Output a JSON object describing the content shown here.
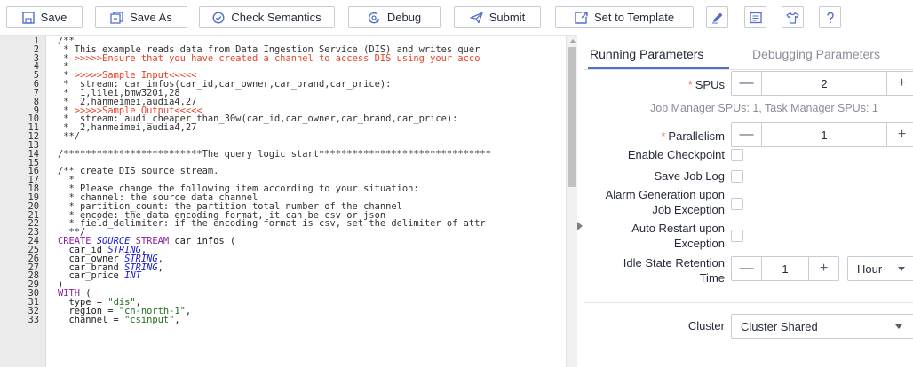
{
  "toolbar": {
    "save": "Save",
    "save_as": "Save As",
    "check_semantics": "Check Semantics",
    "debug": "Debug",
    "submit": "Submit",
    "set_to_template": "Set to Template",
    "accent": "#526ecc",
    "icons": [
      "save-icon",
      "save-as-icon",
      "check-semantics-icon",
      "debug-icon",
      "submit-icon",
      "set-template-icon",
      "pen-icon",
      "format-icon",
      "theme-icon",
      "help-icon"
    ]
  },
  "editor": {
    "lines": [
      {
        "n": "1",
        "segs": [
          {
            "t": "/**",
            "c": "com"
          }
        ]
      },
      {
        "n": "2",
        "segs": [
          {
            "t": " * This example reads data from Data Ingestion Service (DIS) and writes quer",
            "c": "com"
          }
        ]
      },
      {
        "n": "3",
        "segs": [
          {
            "t": " * ",
            "c": "com"
          },
          {
            "t": ">>>>>Ensure that you have created a channel to access DIS using your acco",
            "c": "red"
          }
        ]
      },
      {
        "n": "4",
        "segs": [
          {
            "t": " *",
            "c": "com"
          }
        ]
      },
      {
        "n": "5",
        "segs": [
          {
            "t": " * ",
            "c": "com"
          },
          {
            "t": ">>>>>Sample Input<<<<<",
            "c": "red"
          }
        ]
      },
      {
        "n": "6",
        "segs": [
          {
            "t": " *  stream: car_infos(car_id,car_owner,car_brand,car_price):",
            "c": "com"
          }
        ]
      },
      {
        "n": "7",
        "segs": [
          {
            "t": " *  1,lilei,bmw320i,28",
            "c": "com"
          }
        ]
      },
      {
        "n": "8",
        "segs": [
          {
            "t": " *  2,hanmeimei,audia4,27",
            "c": "com"
          }
        ]
      },
      {
        "n": "9",
        "segs": [
          {
            "t": " * ",
            "c": "com"
          },
          {
            "t": ">>>>>Sample Output<<<<<",
            "c": "red"
          }
        ]
      },
      {
        "n": "10",
        "segs": [
          {
            "t": " *  stream: audi_cheaper_than_30w(car_id,car_owner,car_brand,car_price):",
            "c": "com"
          }
        ]
      },
      {
        "n": "11",
        "segs": [
          {
            "t": " *  2,hanmeimei,audia4,27",
            "c": "com"
          }
        ]
      },
      {
        "n": "12",
        "segs": [
          {
            "t": " **/",
            "c": "com"
          }
        ]
      },
      {
        "n": "13",
        "segs": [
          {
            "t": "",
            "c": "com"
          }
        ]
      },
      {
        "n": "14",
        "segs": [
          {
            "t": "/*************************The query logic start*******************************",
            "c": "com"
          }
        ]
      },
      {
        "n": "15",
        "segs": [
          {
            "t": "",
            "c": "com"
          }
        ]
      },
      {
        "n": "16",
        "segs": [
          {
            "t": "/** create DIS source stream.",
            "c": "com"
          }
        ]
      },
      {
        "n": "17",
        "segs": [
          {
            "t": "  *",
            "c": "com"
          }
        ]
      },
      {
        "n": "18",
        "segs": [
          {
            "t": "  * Please change the following item according to your situation:",
            "c": "com"
          }
        ]
      },
      {
        "n": "19",
        "segs": [
          {
            "t": "  * channel: the source data channel",
            "c": "com"
          }
        ]
      },
      {
        "n": "20",
        "segs": [
          {
            "t": "  * partition_count: the partition total number of the channel",
            "c": "com"
          }
        ]
      },
      {
        "n": "21",
        "segs": [
          {
            "t": "  * encode: the data encoding format, it can be csv or json",
            "c": "com"
          }
        ]
      },
      {
        "n": "22",
        "segs": [
          {
            "t": "  * field_delimiter: if the encoding format is csv, set the delimiter of attr",
            "c": "com"
          }
        ]
      },
      {
        "n": "23",
        "segs": [
          {
            "t": "  **/",
            "c": "com"
          }
        ]
      },
      {
        "n": "24",
        "segs": [
          {
            "t": "CREATE ",
            "c": "kw"
          },
          {
            "t": "SOURCE",
            "c": "ty"
          },
          {
            "t": " STREAM ",
            "c": "kw"
          },
          {
            "t": "car_infos (",
            "c": "plain"
          }
        ]
      },
      {
        "n": "25",
        "segs": [
          {
            "t": "  car_id ",
            "c": "plain"
          },
          {
            "t": "STRING",
            "c": "ty"
          },
          {
            "t": ",",
            "c": "plain"
          }
        ]
      },
      {
        "n": "26",
        "segs": [
          {
            "t": "  car_owner ",
            "c": "plain"
          },
          {
            "t": "STRING",
            "c": "ty"
          },
          {
            "t": ",",
            "c": "plain"
          }
        ]
      },
      {
        "n": "27",
        "segs": [
          {
            "t": "  car_brand ",
            "c": "plain"
          },
          {
            "t": "STRING",
            "c": "ty"
          },
          {
            "t": ",",
            "c": "plain"
          }
        ]
      },
      {
        "n": "28",
        "segs": [
          {
            "t": "  car_price ",
            "c": "plain"
          },
          {
            "t": "INT",
            "c": "ty"
          }
        ]
      },
      {
        "n": "29",
        "segs": [
          {
            "t": ")",
            "c": "plain"
          }
        ]
      },
      {
        "n": "30",
        "segs": [
          {
            "t": "WITH",
            "c": "kw"
          },
          {
            "t": " (",
            "c": "plain"
          }
        ]
      },
      {
        "n": "31",
        "segs": [
          {
            "t": "  type = ",
            "c": "plain"
          },
          {
            "t": "\"dis\"",
            "c": "str"
          },
          {
            "t": ",",
            "c": "plain"
          }
        ]
      },
      {
        "n": "32",
        "segs": [
          {
            "t": "  region = ",
            "c": "plain"
          },
          {
            "t": "\"cn-north-1\"",
            "c": "str"
          },
          {
            "t": ",",
            "c": "plain"
          }
        ]
      },
      {
        "n": "33",
        "segs": [
          {
            "t": "  channel = ",
            "c": "plain"
          },
          {
            "t": "\"csinput\"",
            "c": "str"
          },
          {
            "t": ",",
            "c": "plain"
          }
        ]
      }
    ]
  },
  "panel": {
    "tabs": [
      {
        "label": "Running Parameters",
        "active": true
      },
      {
        "label": "Debugging Parameters",
        "active": false
      }
    ],
    "spus_label": "SPUs",
    "spus_value": "2",
    "spus_hint": "Job Manager SPUs: 1, Task Manager SPUs: 1",
    "parallelism_label": "Parallelism",
    "parallelism_value": "1",
    "required_mark": "*",
    "minus": "—",
    "plus": "+",
    "enable_checkpoint": "Enable Checkpoint",
    "save_job_log": "Save Job Log",
    "alarm_line1": "Alarm Generation upon",
    "alarm_line2": "Job Exception",
    "auto_restart_line1": "Auto Restart upon",
    "auto_restart_line2": "Exception",
    "idle_line1": "Idle State Retention",
    "idle_line2": "Time",
    "idle_value": "1",
    "idle_unit": "Hour",
    "cluster_label": "Cluster",
    "cluster_value": "Cluster Shared"
  }
}
